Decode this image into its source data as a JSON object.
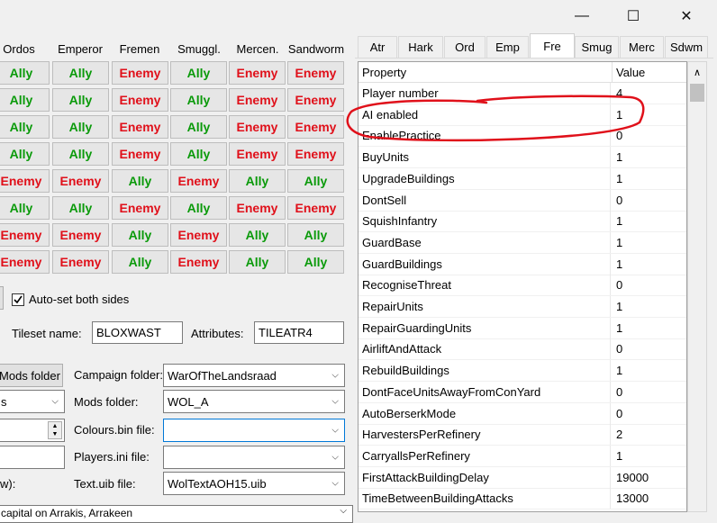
{
  "window": {
    "minimize_glyph": "—",
    "maximize_glyph": "☐",
    "close_glyph": "✕"
  },
  "columns": [
    "Ordos",
    "Emperor",
    "Fremen",
    "Smuggl.",
    "Mercen.",
    "Sandworm"
  ],
  "relations": [
    [
      "Ally",
      "Ally",
      "Enemy",
      "Ally",
      "Enemy",
      "Enemy"
    ],
    [
      "Ally",
      "Ally",
      "Enemy",
      "Ally",
      "Enemy",
      "Enemy"
    ],
    [
      "Ally",
      "Ally",
      "Enemy",
      "Ally",
      "Enemy",
      "Enemy"
    ],
    [
      "Ally",
      "Ally",
      "Enemy",
      "Ally",
      "Enemy",
      "Enemy"
    ],
    [
      "Enemy",
      "Enemy",
      "Ally",
      "Enemy",
      "Ally",
      "Ally"
    ],
    [
      "Ally",
      "Ally",
      "Enemy",
      "Ally",
      "Enemy",
      "Enemy"
    ],
    [
      "Enemy",
      "Enemy",
      "Ally",
      "Enemy",
      "Ally",
      "Ally"
    ],
    [
      "Enemy",
      "Enemy",
      "Ally",
      "Enemy",
      "Ally",
      "Ally"
    ]
  ],
  "autoset": {
    "label": "Auto-set both sides",
    "checked": true
  },
  "tileset": {
    "label": "Tileset name:",
    "value": "BLOXWAST",
    "attributes_label": "Attributes:",
    "attributes_value": "TILEATR4"
  },
  "mods_folder_button": "Mods folder",
  "left_combo_value": "s",
  "campaign": {
    "label": "Campaign folder:",
    "value": "WarOfTheLandsraad"
  },
  "mods": {
    "label": "Mods folder:",
    "value": "WOL_A"
  },
  "colours": {
    "label": "Colours.bin file:",
    "value": ""
  },
  "players": {
    "label": "Players.ini file:",
    "value": ""
  },
  "textuib": {
    "label": "Text.uib file:",
    "value": "WolTextAOH15.uib"
  },
  "left_partial_label": "w):",
  "bottom_partial": "capital on Arrakis, Arrakeen",
  "tabs": [
    "Atr",
    "Hark",
    "Ord",
    "Emp",
    "Fre",
    "Smug",
    "Merc",
    "Sdwm"
  ],
  "active_tab": 4,
  "grid": {
    "header_property": "Property",
    "header_value": "Value",
    "rows": [
      [
        "Player number",
        "4"
      ],
      [
        "AI enabled",
        "1"
      ],
      [
        "EnablePractice",
        "0"
      ],
      [
        "BuyUnits",
        "1"
      ],
      [
        "UpgradeBuildings",
        "1"
      ],
      [
        "DontSell",
        "0"
      ],
      [
        "SquishInfantry",
        "1"
      ],
      [
        "GuardBase",
        "1"
      ],
      [
        "GuardBuildings",
        "1"
      ],
      [
        "RecogniseThreat",
        "0"
      ],
      [
        "RepairUnits",
        "1"
      ],
      [
        "RepairGuardingUnits",
        "1"
      ],
      [
        "AirliftAndAttack",
        "0"
      ],
      [
        "RebuildBuildings",
        "1"
      ],
      [
        "DontFaceUnitsAwayFromConYard",
        "0"
      ],
      [
        "AutoBerserkMode",
        "0"
      ],
      [
        "HarvestersPerRefinery",
        "2"
      ],
      [
        "CarryallsPerRefinery",
        "1"
      ],
      [
        "FirstAttackBuildingDelay",
        "19000"
      ],
      [
        "TimeBetweenBuildingAttacks",
        "13000"
      ]
    ]
  },
  "annotation_color": "#e0101a"
}
